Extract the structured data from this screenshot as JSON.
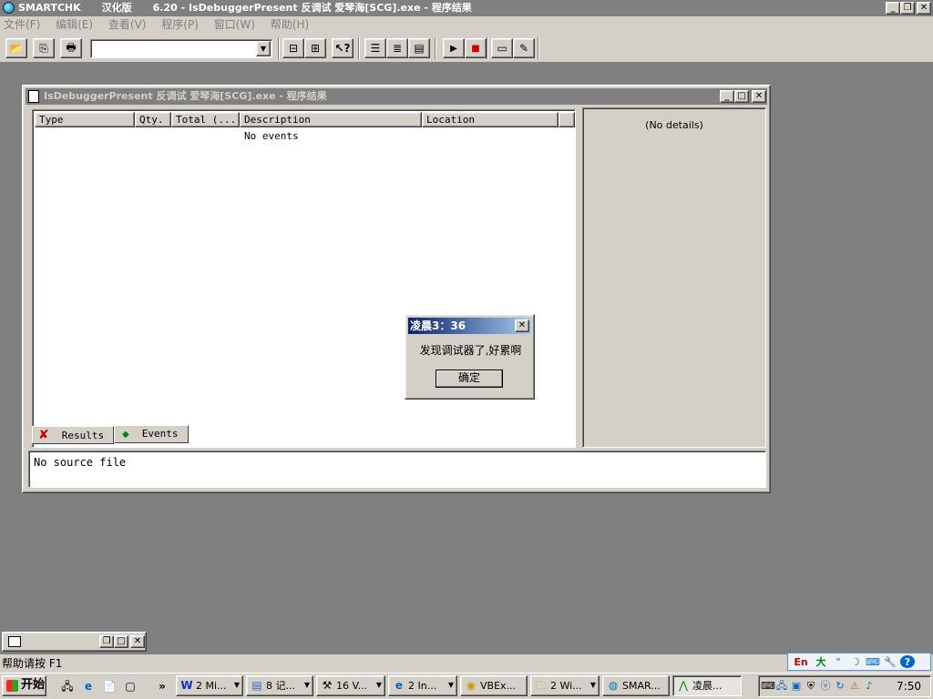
{
  "app": {
    "title_name": "SMARTCHK",
    "title_edition": "汉化版",
    "title_rest": "6.20 - IsDebuggerPresent 反调试 爱琴海[SCG].exe - 程序结果"
  },
  "menu": [
    "文件(F)",
    "编辑(E)",
    "查看(V)",
    "程序(P)",
    "窗口(W)",
    "帮助(H)"
  ],
  "toolbar": {
    "combo_value": "",
    "icons": [
      "open-folder-icon",
      "copy-icon",
      "print-icon",
      "collapse-icon",
      "expand-icon",
      "help-pointer-icon",
      "list-icon",
      "list-alt-icon",
      "list-detail-icon",
      "play-icon",
      "stop-icon",
      "window-icon",
      "window-edit-icon"
    ]
  },
  "child": {
    "title": "IsDebuggerPresent 反调试 爱琴海[SCG].exe - 程序结果",
    "columns": [
      "Type",
      "Qty.",
      "Total (...",
      "Description",
      "Location"
    ],
    "empty_text": "No events",
    "tabs": [
      "Results",
      "Events"
    ],
    "details_text": "(No details)",
    "source_text": "No source file"
  },
  "dialog": {
    "title": "凌晨3：36",
    "message": "发现调试器了,好累啊",
    "ok_label": "确定"
  },
  "statusbar": {
    "text": "帮助请按 F1"
  },
  "taskbar": {
    "start_label": "开始",
    "more_label": "»",
    "tasks": [
      {
        "label": "2 Mi...",
        "icon": "word-icon"
      },
      {
        "label": "8 记...",
        "icon": "notepad-icon"
      },
      {
        "label": "16 V...",
        "icon": "tool-icon"
      },
      {
        "label": "2 In...",
        "icon": "ie-icon"
      },
      {
        "label": "VBEx...",
        "icon": "vbexplorer-icon"
      },
      {
        "label": "2 Wi...",
        "icon": "folder-icon"
      },
      {
        "label": "SMAR...",
        "icon": "smartchk-icon"
      },
      {
        "label": "凌晨...",
        "icon": "app-icon"
      }
    ],
    "clock": "7:50"
  },
  "ime": {
    "items": [
      "En",
      "大",
      "\"",
      "☽",
      "⌨",
      "🔧",
      "?"
    ]
  },
  "colors": {
    "title_inactive": "#808080",
    "dialog_title": "#0a246a",
    "desktop": "#808080",
    "face": "#d4d0c8"
  }
}
